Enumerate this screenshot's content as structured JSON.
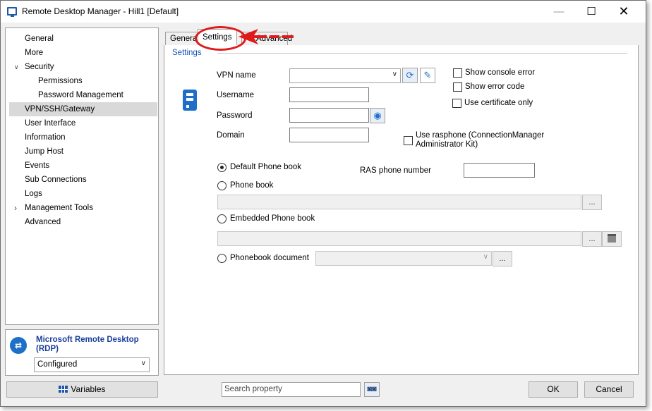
{
  "window": {
    "title": "Remote Desktop Manager - Hill1 [Default]",
    "minimize_glyph": "—",
    "maximize_glyph": "☐",
    "close_glyph": "✕"
  },
  "sidebar": {
    "items": [
      {
        "label": "General"
      },
      {
        "label": "More"
      },
      {
        "label": "Security",
        "expanded": true
      },
      {
        "label": "Permissions"
      },
      {
        "label": "Password Management"
      },
      {
        "label": "VPN/SSH/Gateway",
        "selected": true
      },
      {
        "label": "User Interface"
      },
      {
        "label": "Information"
      },
      {
        "label": "Jump Host"
      },
      {
        "label": "Events"
      },
      {
        "label": "Sub Connections"
      },
      {
        "label": "Logs"
      },
      {
        "label": "Management Tools",
        "expanded": false
      },
      {
        "label": "Advanced"
      }
    ],
    "expanded_caret": "∨",
    "collapsed_caret": "›"
  },
  "entry_type": {
    "name": "Microsoft Remote Desktop (RDP)",
    "icon": "rdp-icon",
    "status_selected": "Configured"
  },
  "tabs": [
    {
      "label": "General"
    },
    {
      "label": "Settings",
      "active": true
    },
    {
      "label": "Advanced"
    }
  ],
  "settings": {
    "section_title": "Settings",
    "vpn_name_label": "VPN name",
    "vpn_name_value": "",
    "username_label": "Username",
    "username_value": "",
    "password_label": "Password",
    "password_value": "",
    "domain_label": "Domain",
    "domain_value": "",
    "show_console_error": "Show console error",
    "show_error_code": "Show error code",
    "use_certificate_only": "Use certificate only",
    "use_rasphone": "Use rasphone (ConnectionManager Administrator Kit)",
    "default_phone_book": "Default Phone book",
    "phone_book": "Phone book",
    "embedded_phone_book": "Embedded Phone book",
    "phonebook_document": "Phonebook document",
    "ras_phone_number_label": "RAS  phone number",
    "ras_phone_number_value": "",
    "ellipsis": "..."
  },
  "bottom": {
    "variables_button": "Variables",
    "search_placeholder": "Search property",
    "ok_button": "OK",
    "cancel_button": "Cancel"
  },
  "colors": {
    "accent_blue": "#1e6fc8",
    "title_blue": "#1a3f9a",
    "annotation_red": "#e0191a",
    "selected_row": "#d9d9d9"
  }
}
